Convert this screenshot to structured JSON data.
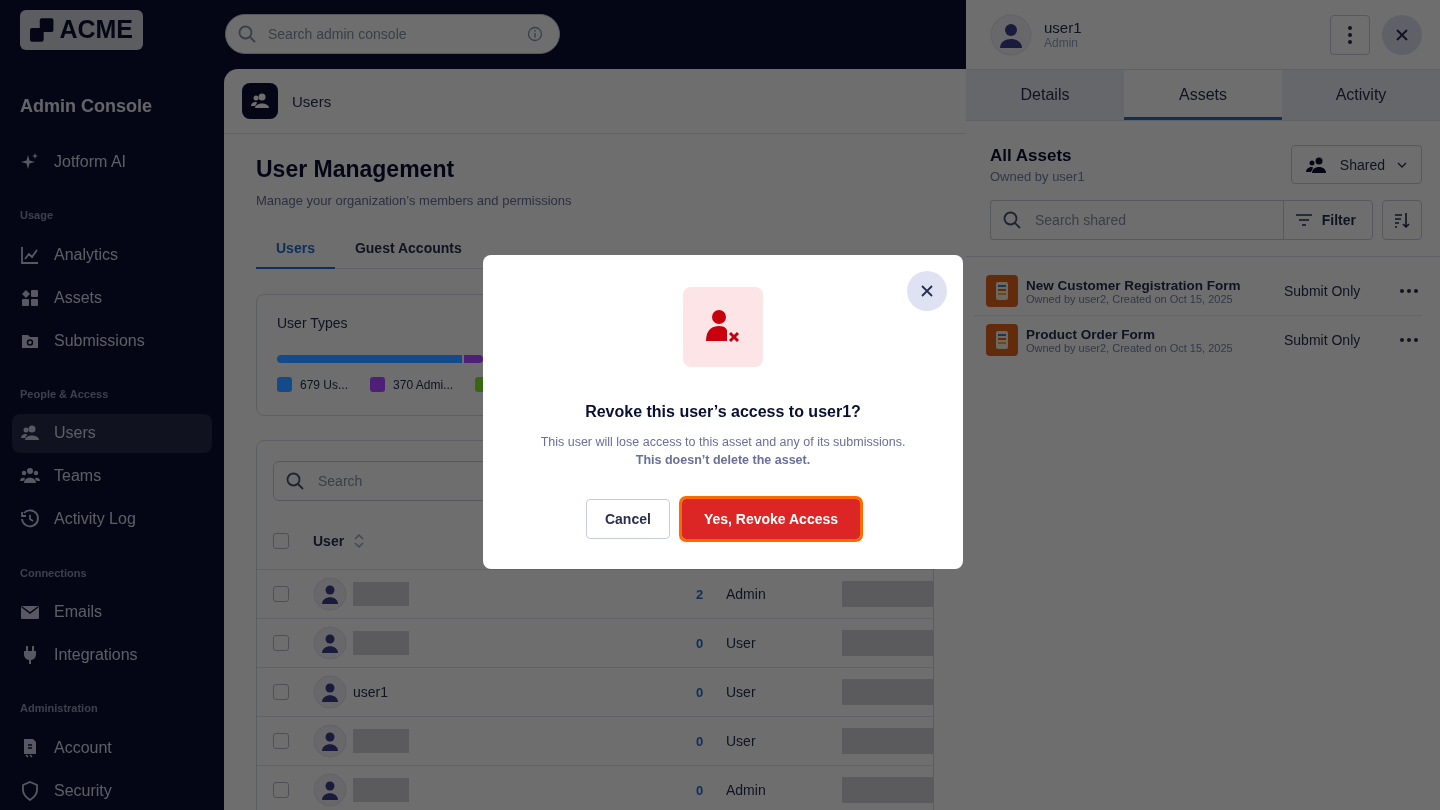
{
  "sidebar": {
    "logo": "ACME",
    "title": "Admin Console",
    "top_items": [
      {
        "label": "Jotform AI",
        "selected": false
      }
    ],
    "sections": [
      {
        "heading": "Usage",
        "items": [
          {
            "label": "Analytics",
            "selected": false
          },
          {
            "label": "Assets",
            "selected": false
          },
          {
            "label": "Submissions",
            "selected": false
          }
        ]
      },
      {
        "heading": "People & Access",
        "items": [
          {
            "label": "Users",
            "selected": true
          },
          {
            "label": "Teams",
            "selected": false
          },
          {
            "label": "Activity Log",
            "selected": false
          }
        ]
      },
      {
        "heading": "Connections",
        "items": [
          {
            "label": "Emails",
            "selected": false
          },
          {
            "label": "Integrations",
            "selected": false
          }
        ]
      },
      {
        "heading": "Administration",
        "items": [
          {
            "label": "Account",
            "selected": false
          },
          {
            "label": "Security",
            "selected": false
          }
        ]
      }
    ]
  },
  "top_search": {
    "placeholder": "Search admin console"
  },
  "page": {
    "breadcrumb": "Users",
    "title": "User Management",
    "subtitle": "Manage your organization’s members and permissions",
    "tabs": [
      {
        "label": "Users",
        "selected": true
      },
      {
        "label": "Guest Accounts",
        "selected": false
      }
    ],
    "user_types": {
      "title": "User Types",
      "segments": [
        {
          "color": "#134a8a",
          "level": 0.9
        },
        {
          "color": "#4e1f78",
          "level": 0.1
        }
      ],
      "legend": [
        {
          "label": "679 Us...",
          "color": "#134a8a"
        },
        {
          "label": "370 Admi...",
          "color": "#4e1f78"
        },
        {
          "color": "#3a6612"
        }
      ]
    },
    "table": {
      "search_placeholder": "Search",
      "columns": [
        "User"
      ],
      "select_all_checked": false,
      "rows": [
        {
          "checked": false,
          "redacted": true,
          "count": "2",
          "role": "Admin"
        },
        {
          "checked": false,
          "redacted": true,
          "count": "0",
          "role": "User"
        },
        {
          "checked": false,
          "redacted": false,
          "name": "user1",
          "count": "0",
          "role": "User"
        },
        {
          "checked": false,
          "redacted": true,
          "count": "0",
          "role": "User"
        },
        {
          "checked": false,
          "redacted": true,
          "count": "0",
          "role": "Admin"
        }
      ]
    }
  },
  "drawer": {
    "user": "user1",
    "role": "Admin",
    "tabs": [
      {
        "label": "Details",
        "selected": false
      },
      {
        "label": "Assets",
        "selected": true
      },
      {
        "label": "Activity",
        "selected": false
      }
    ],
    "title": "All Assets",
    "subtitle": "Owned by user1",
    "dropdown": "Shared",
    "search_placeholder": "Search shared",
    "filter": "Filter",
    "assets": [
      {
        "title": "New Customer Registration Form",
        "meta": "Owned by user2, Created on Oct 15, 2025",
        "permission": "Submit Only"
      },
      {
        "title": "Product Order Form",
        "meta": "Owned by user2, Created on Oct 15, 2025",
        "permission": "Submit Only"
      }
    ]
  },
  "dialog": {
    "title": "Revoke this user’s access to user1?",
    "body": "This user will lose access to this asset and any of its submissions. **This doesn’t delete the asset.**",
    "buttons": [
      {
        "label": "Cancel",
        "kind": "secondary",
        "focused": false
      },
      {
        "label": "Yes, Revoke Access",
        "kind": "danger",
        "focused": true
      }
    ]
  }
}
